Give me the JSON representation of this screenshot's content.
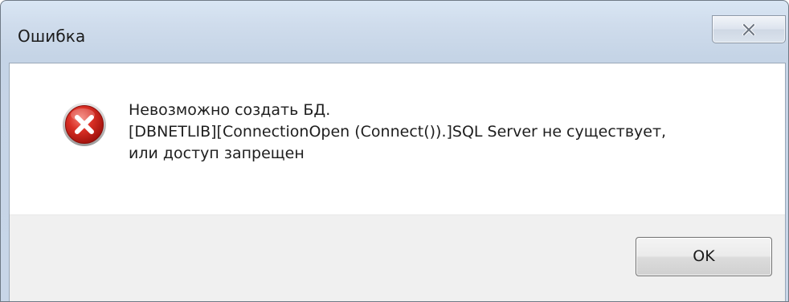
{
  "window": {
    "title": "Ошибка"
  },
  "titlebar": {
    "close_icon": "close-icon"
  },
  "message": {
    "icon": "error-icon",
    "lines": [
      "Невозможно создать БД.",
      "[DBNETLIB][ConnectionOpen (Connect()).]SQL Server не существует,",
      "или доступ запрещен"
    ]
  },
  "buttons": {
    "ok_label": "OK"
  },
  "colors": {
    "titlebar_top": "#d9e6f4",
    "titlebar_bottom": "#c8d6e8",
    "error_red": "#d42a2a",
    "footer_bg": "#f0f0f0"
  }
}
